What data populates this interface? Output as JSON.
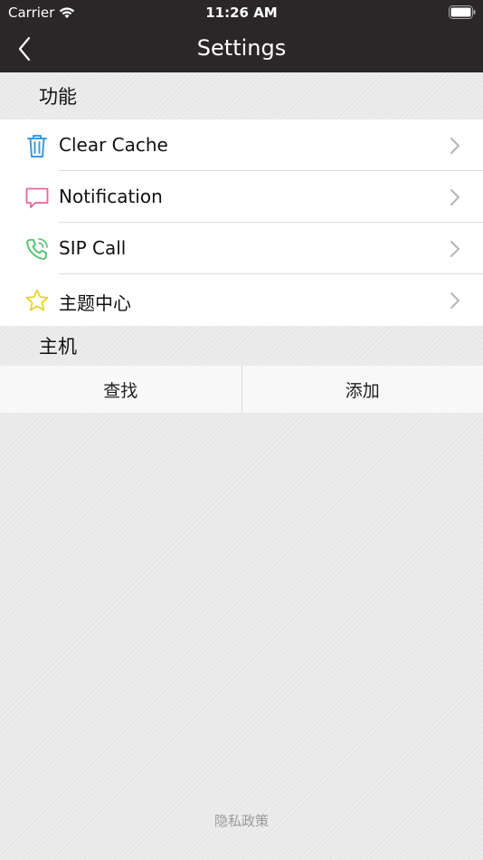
{
  "status_bar": {
    "carrier": "Carrier",
    "time": "11:26 AM"
  },
  "nav": {
    "title": "Settings",
    "back_icon": "chevron-left-icon"
  },
  "sections": {
    "features": {
      "title": "功能",
      "items": [
        {
          "label": "Clear Cache",
          "icon": "trash-icon",
          "icon_color": "#3a9be0"
        },
        {
          "label": "Notification",
          "icon": "message-icon",
          "icon_color": "#e8649a"
        },
        {
          "label": "SIP Call",
          "icon": "phone-icon",
          "icon_color": "#4cc36b"
        },
        {
          "label": "主题中心",
          "icon": "star-icon",
          "icon_color": "#e8d52a"
        }
      ]
    },
    "host": {
      "title": "主机",
      "buttons": {
        "find": "查找",
        "add": "添加"
      }
    }
  },
  "footer": {
    "privacy": "隐私政策"
  },
  "colors": {
    "header_bg": "#2b2627",
    "background": "#ececec",
    "chevron": "#b5b5b5"
  }
}
